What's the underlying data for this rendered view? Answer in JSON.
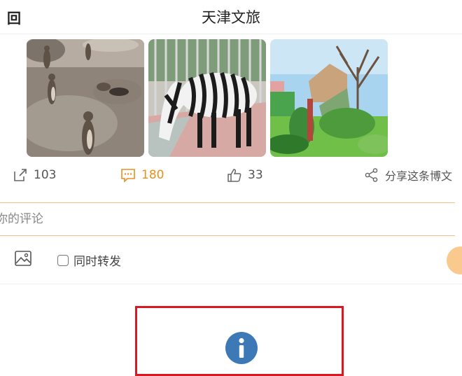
{
  "header": {
    "back_label": "回",
    "title": "天津文旅"
  },
  "photos": [
    {
      "icon": "meerkats-photo"
    },
    {
      "icon": "zebra-photo"
    },
    {
      "icon": "zoo-garden-photo"
    }
  ],
  "actions": {
    "reposts": "103",
    "comments": "180",
    "likes": "33",
    "share_label": "分享这条博文"
  },
  "comment": {
    "placeholder": "你的评论"
  },
  "tools": {
    "repost_label": "同时转发"
  },
  "colors": {
    "accent": "#e8901d",
    "alert_border": "#d71921",
    "info_blue": "#3d79b6"
  }
}
